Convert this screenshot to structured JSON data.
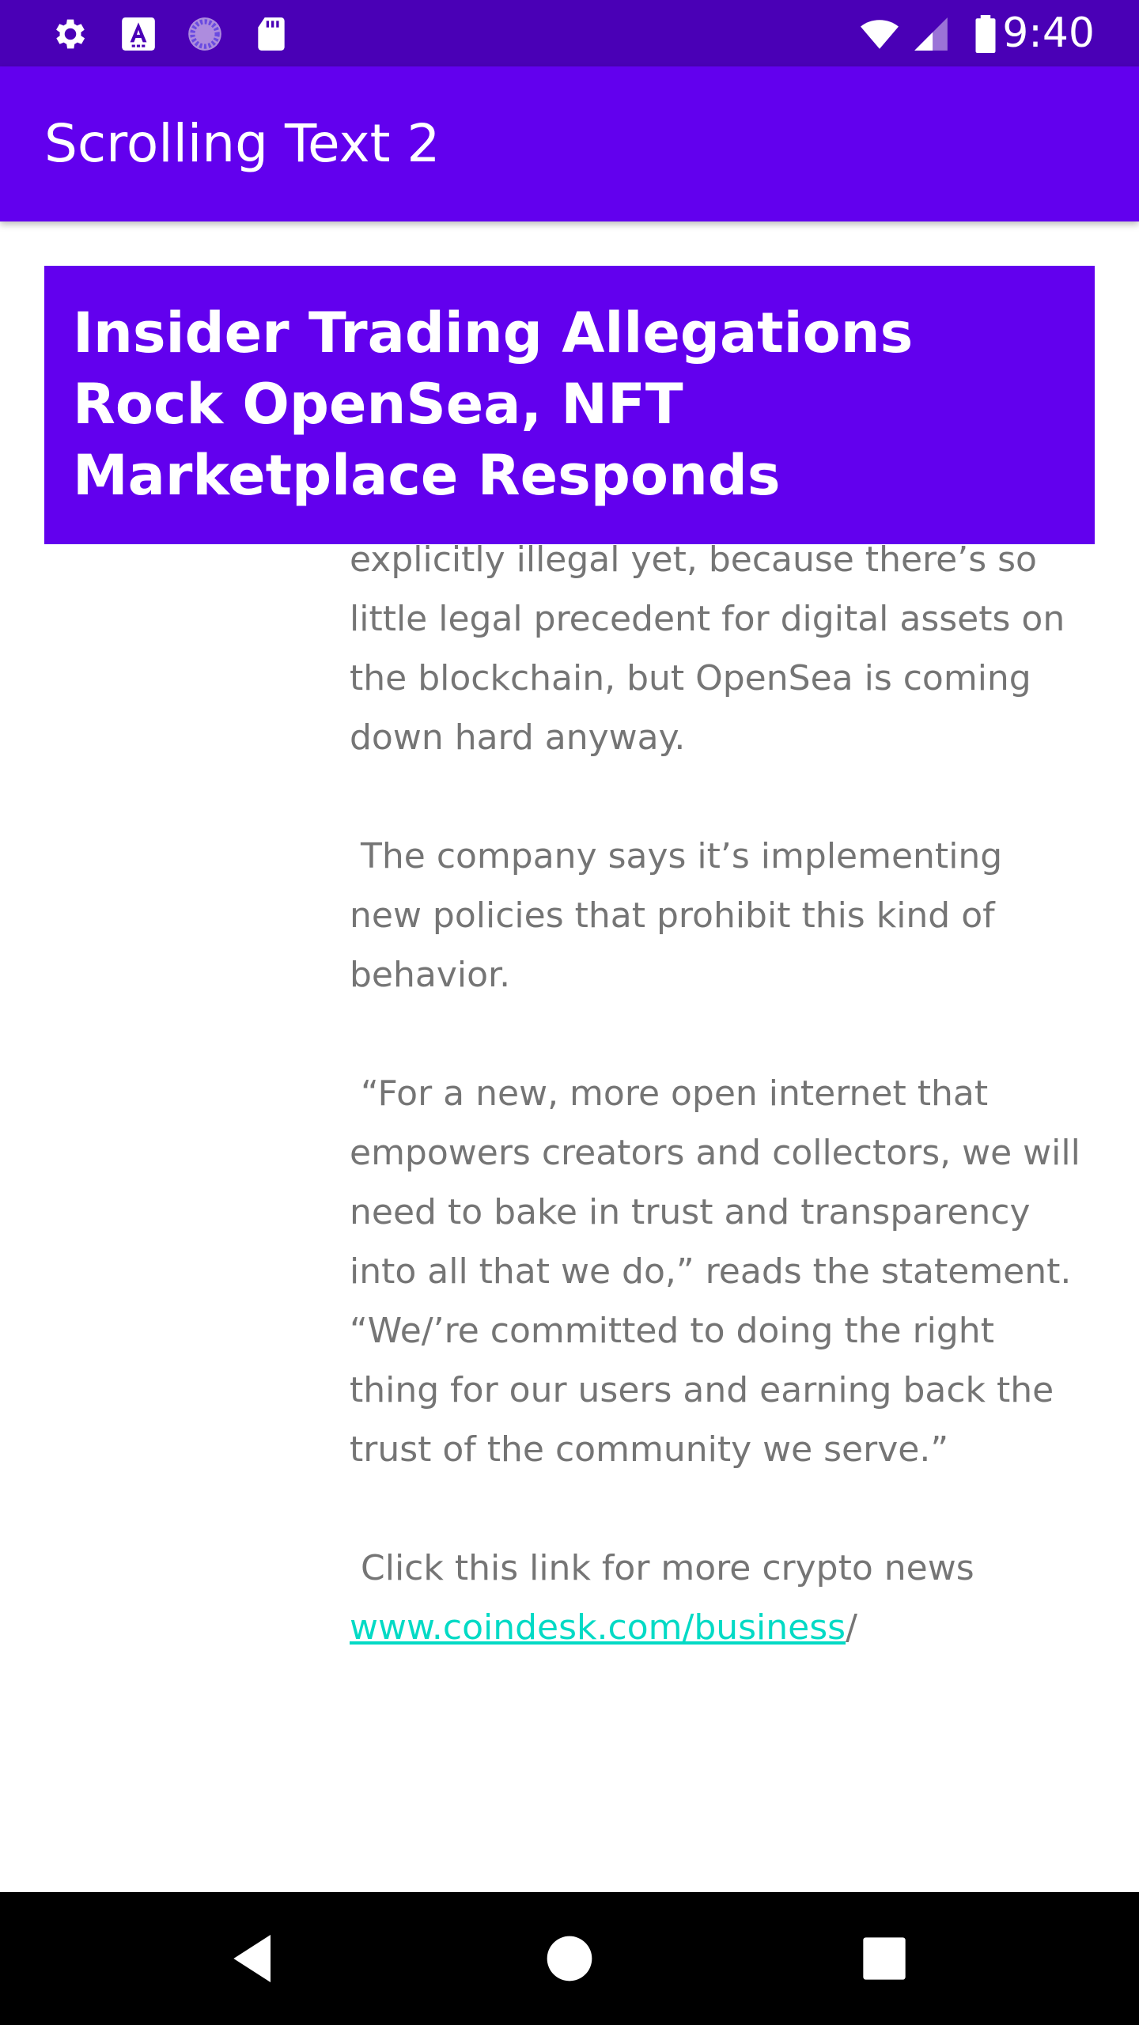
{
  "status_bar": {
    "icons": [
      "gear-icon",
      "font-a-icon",
      "sync-circle-icon",
      "sd-card-icon",
      "wifi-icon",
      "cellular-signal-icon",
      "battery-icon"
    ],
    "time": "9:40",
    "color": "#4a00b6"
  },
  "app_bar": {
    "title": "Scrolling Text 2",
    "color": "#6200ee"
  },
  "headline": {
    "text": "Insider Trading Allegations Rock OpenSea, NFT Marketplace Responds"
  },
  "article": {
    "paragraphs": [
      "explicitly illegal yet, because there’s so little legal precedent for digital assets on the blockchain, but OpenSea is coming down hard anyway.",
      " The company says it’s implementing new policies that prohibit this kind of behavior.",
      " “For a new, more open internet that empowers creators and collectors, we will need to bake in trust and transparency into all that we do,” reads the statement. “We/’re committed to doing the right thing for our users and earning back the trust of the community we serve.”",
      " Click this link for more crypto news"
    ],
    "link_text": "www.coindesk.com/business",
    "link_suffix": "/",
    "text_color": "#757575",
    "link_color": "#03dac5"
  },
  "nav_bar": {
    "icons": [
      "back-icon",
      "home-icon",
      "recents-icon"
    ]
  }
}
